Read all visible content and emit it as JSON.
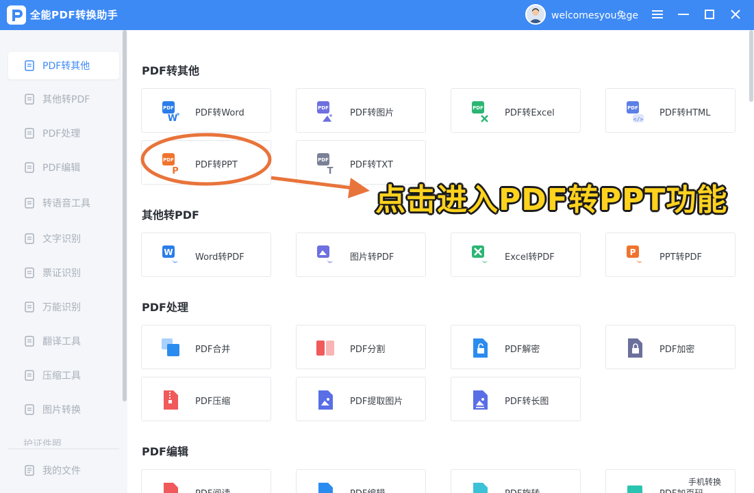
{
  "app": {
    "title": "全能PDF转换助手",
    "user_name": "welcomesyou兔ge",
    "accent": "#3d8af5"
  },
  "window_controls": [
    {
      "name": "menu-button",
      "icon": "hamburger-icon"
    },
    {
      "name": "minimize-button",
      "icon": "minimize-icon"
    },
    {
      "name": "maximize-button",
      "icon": "maximize-icon"
    },
    {
      "name": "close-button",
      "icon": "close-icon"
    }
  ],
  "sidebar": {
    "items": [
      {
        "label": "PDF转其他",
        "icon": "pdf-icon",
        "active": true
      },
      {
        "label": "其他转PDF",
        "icon": "pdf-icon"
      },
      {
        "label": "PDF处理",
        "icon": "document-tool-icon"
      },
      {
        "label": "PDF编辑",
        "icon": "edit-document-icon"
      },
      {
        "label": "转语音工具",
        "icon": "speech-icon"
      },
      {
        "label": "文字识别",
        "icon": "text-recognition-icon"
      },
      {
        "label": "票证识别",
        "icon": "ticket-recognition-icon"
      },
      {
        "label": "万能识别",
        "icon": "universal-recognition-icon"
      },
      {
        "label": "翻译工具",
        "icon": "translate-icon"
      },
      {
        "label": "压缩工具",
        "icon": "compress-icon"
      },
      {
        "label": "图片转换",
        "icon": "image-convert-icon"
      }
    ],
    "partial_item": "护证件照",
    "footer_item": {
      "label": "我的文件",
      "icon": "my-files-icon"
    }
  },
  "sections": [
    {
      "title": "PDF转其他",
      "cards": [
        {
          "label": "PDF转Word",
          "icon": "pdf-to-word-icon",
          "color": "#2b7de9"
        },
        {
          "label": "PDF转图片",
          "icon": "pdf-to-image-icon",
          "color": "#6e6fe0"
        },
        {
          "label": "PDF转Excel",
          "icon": "pdf-to-excel-icon",
          "color": "#2bb673"
        },
        {
          "label": "PDF转HTML",
          "icon": "pdf-to-html-icon",
          "color": "#5b7fe6"
        },
        {
          "label": "PDF转PPT",
          "icon": "pdf-to-ppt-icon",
          "color": "#f0732e"
        },
        {
          "label": "PDF转TXT",
          "icon": "pdf-to-txt-icon",
          "color": "#7a8096"
        }
      ]
    },
    {
      "title": "其他转PDF",
      "cards": [
        {
          "label": "Word转PDF",
          "icon": "word-to-pdf-icon",
          "color": "#2b7de9"
        },
        {
          "label": "图片转PDF",
          "icon": "image-to-pdf-icon",
          "color": "#6e6fe0"
        },
        {
          "label": "Excel转PDF",
          "icon": "excel-to-pdf-icon",
          "color": "#2bb673"
        },
        {
          "label": "PPT转PDF",
          "icon": "ppt-to-pdf-icon",
          "color": "#f0732e"
        }
      ]
    },
    {
      "title": "PDF处理",
      "cards": [
        {
          "label": "PDF合并",
          "icon": "merge-icon",
          "color": "#2b8cf0"
        },
        {
          "label": "PDF分割",
          "icon": "split-icon",
          "color": "#f05a5a"
        },
        {
          "label": "PDF解密",
          "icon": "unlock-icon",
          "color": "#2b8cf0"
        },
        {
          "label": "PDF加密",
          "icon": "lock-icon",
          "color": "#6b6f9c"
        },
        {
          "label": "PDF压缩",
          "icon": "zip-icon",
          "color": "#f05a5a"
        },
        {
          "label": "PDF提取图片",
          "icon": "extract-image-icon",
          "color": "#5a6ee6"
        },
        {
          "label": "PDF转长图",
          "icon": "long-image-icon",
          "color": "#5a6ee6"
        }
      ]
    },
    {
      "title": "PDF编辑",
      "cards": [
        {
          "label": "PDF阅读",
          "icon": "read-icon",
          "color": "#f05a5a"
        },
        {
          "label": "PDF编辑",
          "icon": "edit-icon",
          "color": "#2b8cf0"
        },
        {
          "label": "PDF旋转",
          "icon": "rotate-icon",
          "color": "#3cc2d6"
        },
        {
          "label": "PDF加页码",
          "icon": "page-number-icon",
          "color": "#2bc4b0"
        }
      ]
    }
  ],
  "annotation": {
    "text": "点击进入PDF转PPT功能",
    "color": "#ffd21e",
    "arrow_color": "#e8743b"
  },
  "phone_convert_label": "手机转换"
}
